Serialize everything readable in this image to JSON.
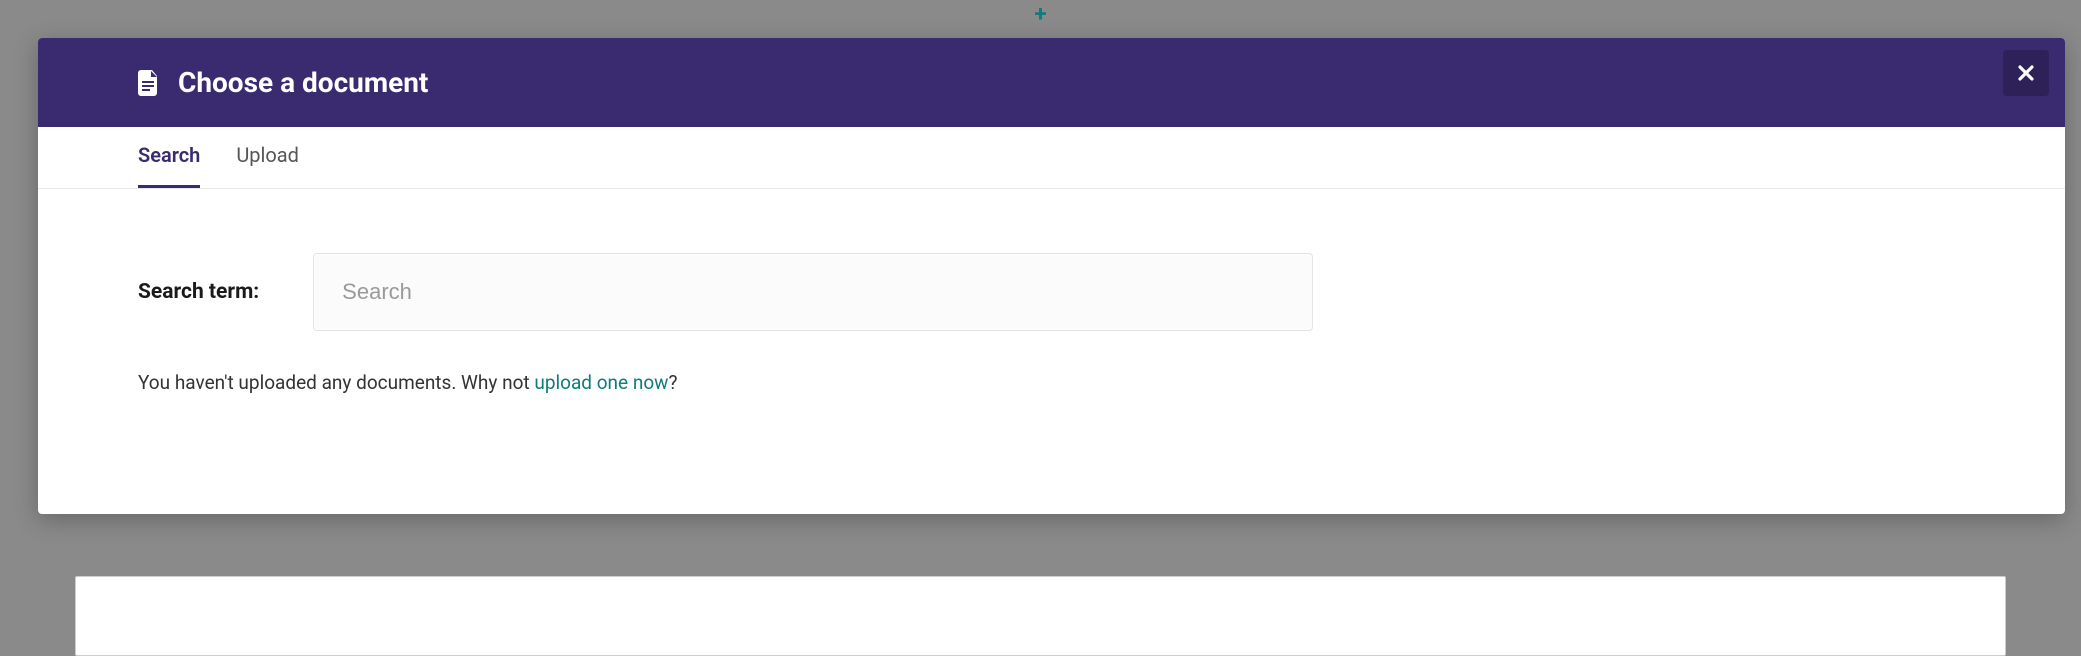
{
  "modal": {
    "title": "Choose a document",
    "tabs": [
      {
        "label": "Search",
        "active": true
      },
      {
        "label": "Upload",
        "active": false
      }
    ]
  },
  "search": {
    "label": "Search term:",
    "placeholder": "Search",
    "value": ""
  },
  "empty": {
    "prefix": "You haven't uploaded any documents. Why not ",
    "link": "upload one now",
    "suffix": "?"
  }
}
